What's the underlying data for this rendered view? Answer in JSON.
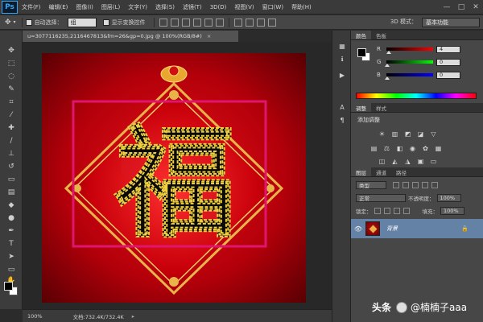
{
  "app": {
    "logo": "Ps",
    "menus": [
      "文件(F)",
      "编辑(E)",
      "图像(I)",
      "图层(L)",
      "文字(Y)",
      "选择(S)",
      "滤镜(T)",
      "3D(D)",
      "视图(V)",
      "窗口(W)",
      "帮助(H)"
    ],
    "window_controls": [
      "—",
      "□",
      "✕"
    ]
  },
  "options": {
    "auto_select_label": "自动选择：",
    "auto_select_value": "组",
    "show_transform_label": "显示变换控件",
    "mode_3d_label": "3D 模式：",
    "workspace": "基本功能"
  },
  "document": {
    "tab_title": "u=3077116235,2116467813&fm=26&gp=0.jpg @ 100%(RGB/8#)",
    "close_glyph": "×",
    "character": "福"
  },
  "status": {
    "zoom": "100%",
    "doc_info": "文档:732.4K/732.4K",
    "arrow": "▸"
  },
  "color_panel": {
    "tabs": [
      "颜色",
      "色板"
    ],
    "sliders": [
      {
        "label": "R",
        "value": "4",
        "track_color_start": "#000000",
        "track_color_end": "#ff0000"
      },
      {
        "label": "G",
        "value": "0",
        "track_color_start": "#000000",
        "track_color_end": "#00ff00"
      },
      {
        "label": "B",
        "value": "0",
        "track_color_start": "#000000",
        "track_color_end": "#0000ff"
      }
    ]
  },
  "adjust_panel": {
    "tabs": [
      "调整",
      "样式"
    ],
    "title": "添加调整"
  },
  "layers_panel": {
    "tabs": [
      "图层",
      "通道",
      "路径"
    ],
    "kind_label": "类型",
    "blend_mode": "正常",
    "opacity_label": "不透明度：",
    "opacity_value": "100%",
    "lock_label": "锁定：",
    "fill_label": "填充：",
    "fill_value": "100%",
    "layer_name": "背景"
  },
  "watermark": {
    "brand": "头条",
    "handle": "@楠楠子aaa"
  },
  "colors": {
    "selection_border": "#e0156e",
    "canvas_red": "#c8000a",
    "gold": "#e8b44a",
    "layer_highlight": "#6482a5"
  }
}
